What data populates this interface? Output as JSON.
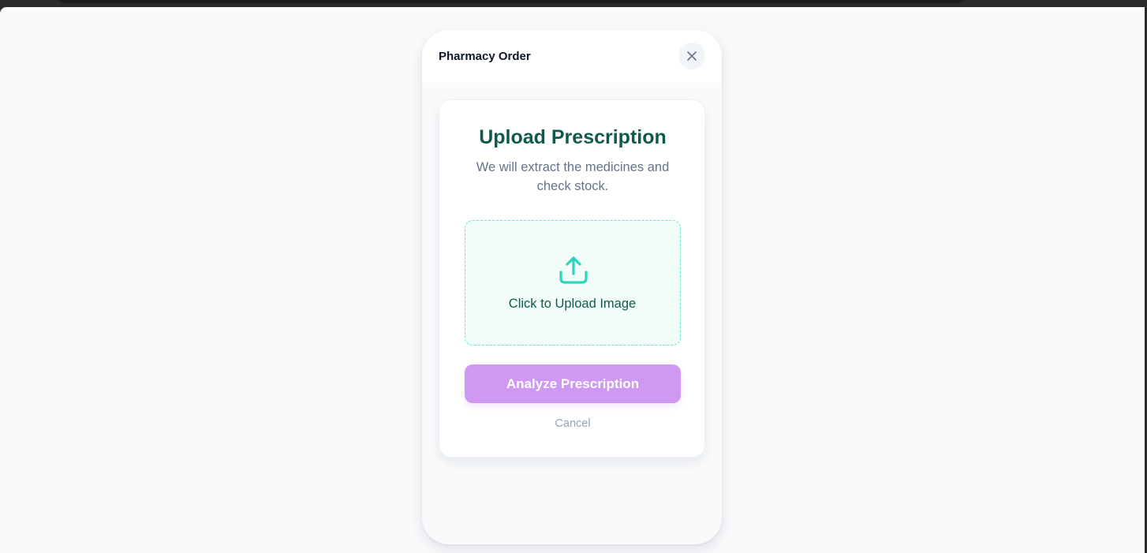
{
  "modal": {
    "title": "Pharmacy Order",
    "close_icon": "close-icon"
  },
  "card": {
    "title": "Upload Prescription",
    "subtitle": "We will extract the medicines and check stock.",
    "dropzone": {
      "icon": "upload-icon",
      "label": "Click to Upload Image"
    },
    "analyze_label": "Analyze Prescription",
    "cancel_label": "Cancel"
  },
  "colors": {
    "accent_teal": "#2dd4bf",
    "heading_green": "#0f5a4c",
    "button_purple": "#cf99f3",
    "page_background": "#f8fafc"
  }
}
